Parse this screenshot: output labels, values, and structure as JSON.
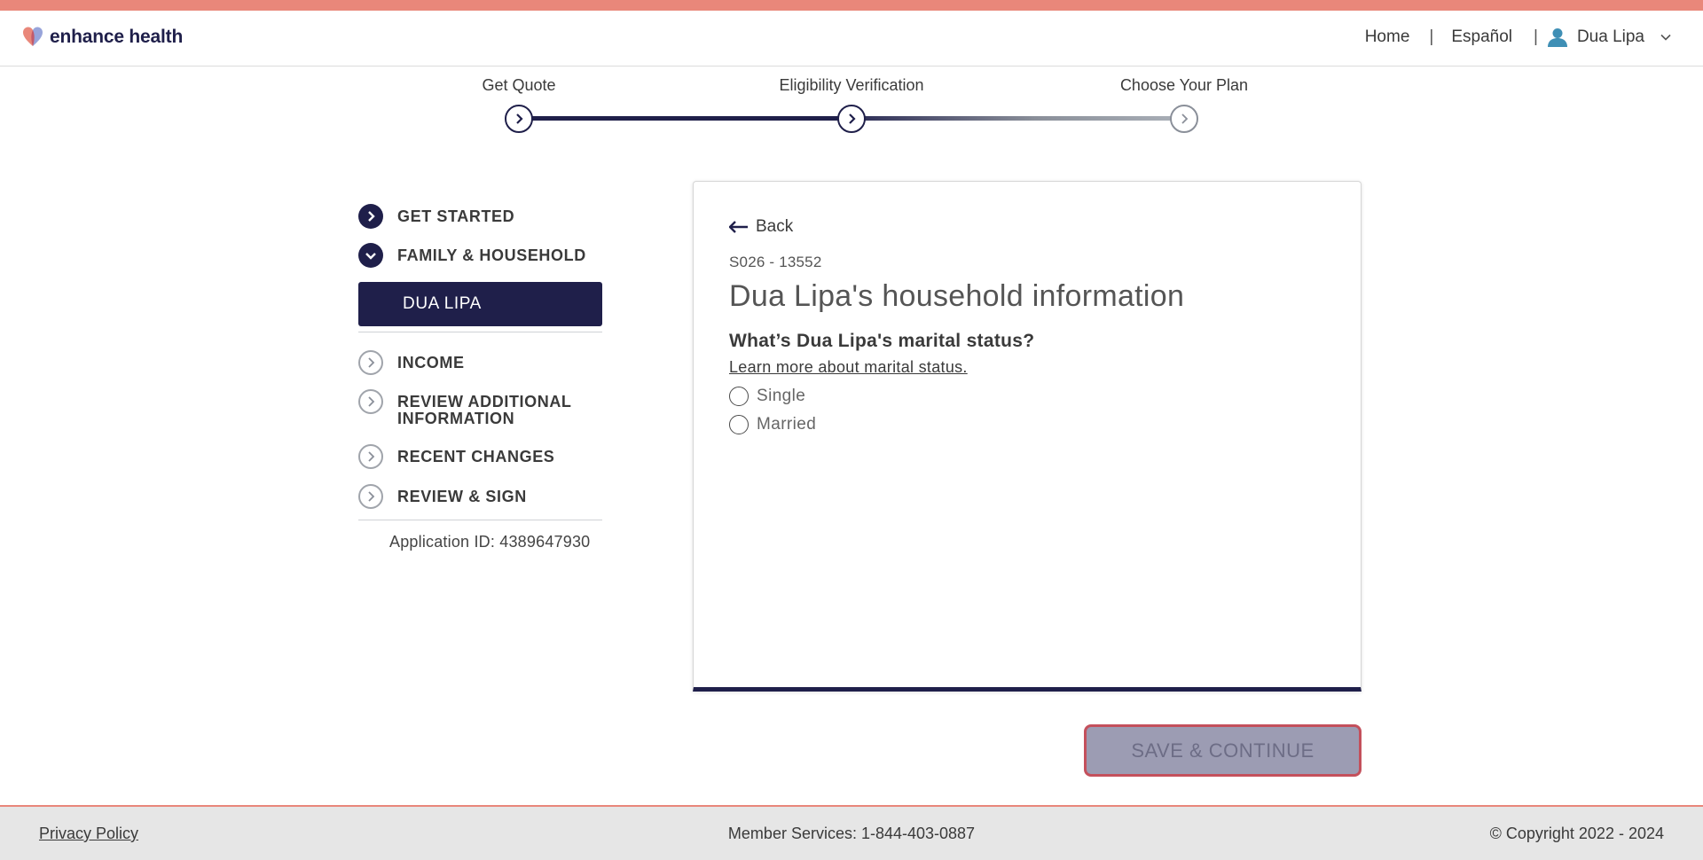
{
  "brand": {
    "name": "enhance health",
    "accent_color": "#e9877a",
    "primary_color": "#1f1f4a"
  },
  "topnav": {
    "home": "Home",
    "language": "Español",
    "separator": "|",
    "user_name": "Dua Lipa"
  },
  "progress": {
    "steps": [
      {
        "label": "Get Quote",
        "state": "done"
      },
      {
        "label": "Eligibility Verification",
        "state": "current"
      },
      {
        "label": "Choose Your Plan",
        "state": "todo"
      }
    ]
  },
  "sidebar": {
    "items": [
      {
        "label": "GET STARTED",
        "icon": "chevron-right-icon",
        "state": "completed"
      },
      {
        "label": "FAMILY & HOUSEHOLD",
        "icon": "chevron-down-icon",
        "state": "expanded"
      },
      {
        "label": "INCOME",
        "icon": "chevron-right-icon",
        "state": "todo"
      },
      {
        "label": "REVIEW ADDITIONAL INFORMATION",
        "icon": "chevron-right-icon",
        "state": "todo"
      },
      {
        "label": "RECENT CHANGES",
        "icon": "chevron-right-icon",
        "state": "todo"
      },
      {
        "label": "REVIEW & SIGN",
        "icon": "chevron-right-icon",
        "state": "todo"
      }
    ],
    "active_member": "DUA LIPA",
    "application_id": "Application ID: 4389647930"
  },
  "card": {
    "back_label": "Back",
    "case_id": "S026 - 13552",
    "title": "Dua Lipa's household information",
    "question": "What’s Dua Lipa's marital status?",
    "learn_more": "Learn more about marital status.",
    "options": [
      "Single",
      "Married"
    ]
  },
  "actions": {
    "save_continue": "SAVE & CONTINUE"
  },
  "footer": {
    "privacy": "Privacy Policy",
    "member_services": "Member Services: 1-844-403-0887",
    "copyright": "© Copyright 2022 - 2024"
  }
}
